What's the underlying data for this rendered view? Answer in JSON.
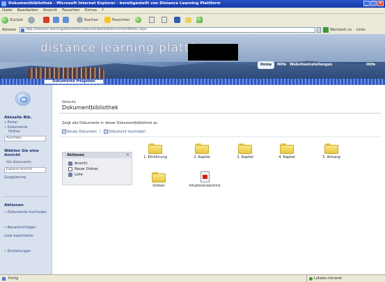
{
  "window": {
    "title": "Dokumentbibliothek - Microsoft Internet Explorer - bereitgestellt von Distance Learning Plattform"
  },
  "menubar": [
    "Datei",
    "Bearbeiten",
    "Ansicht",
    "Favoriten",
    "Extras",
    "?"
  ],
  "toolbar": {
    "back": "Zurück",
    "search": "Suchen",
    "favorites": "Favoriten"
  },
  "address": {
    "label": "Adresse",
    "url": "http://distance-learning/dokumente/Dokumentbibliothek/Forms/AllItems.aspx",
    "go": "Wechseln zu",
    "links": "Links"
  },
  "banner": {
    "title": "distance  learning  plattform",
    "home": "Home",
    "nav": [
      "Hilfe",
      "Websiteeinstellungen",
      "Hilfe"
    ]
  },
  "strip": {
    "active": "Dokumente freigeben"
  },
  "sidebar": {
    "section1": "Aktuelle Bib.",
    "links1": [
      "• Portal",
      "• Dokumente",
      "Ordner"
    ],
    "field1": "Ansichten",
    "section2": "Wählen Sie eine Ansicht",
    "views": [
      "Alle Dokumente",
      "Explorer-Ansicht"
    ],
    "views_extra": "Gruppierung",
    "section3": "Aktionen",
    "actions": [
      "• Dokumente hochladen",
      "• Benachrichtigen",
      "Liste exportieren",
      "• Einstellungen"
    ]
  },
  "main": {
    "breadcrumb": "Website",
    "title": "Dokumentbibliothek",
    "description": "Zeigt alle Dokumente in dieser Dokumentbibliothek an.",
    "actions": [
      "Neues Dokument",
      "Dokument hochladen"
    ],
    "action_box": {
      "header": "Aktionen",
      "close": "×",
      "items": [
        "Ansicht",
        "Neuer Ordner",
        "Liste"
      ]
    },
    "folders": [
      "1. Einführung",
      "2. Kapitel",
      "3. Kapitel",
      "4. Kapitel",
      "5. Anhang",
      "Ordner"
    ],
    "file": "Inhaltsverzeichnis"
  },
  "statusbar": {
    "status": "Fertig",
    "zone": "Lokales Intranet"
  }
}
